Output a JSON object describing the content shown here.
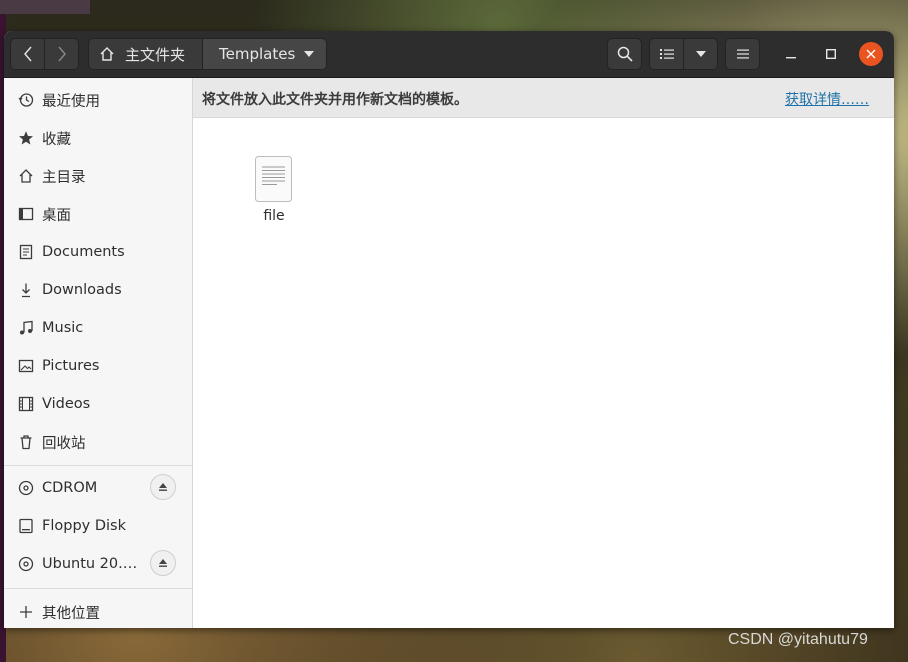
{
  "headerbar": {
    "path_home_label": "主文件夹",
    "path_current_label": "Templates"
  },
  "sidebar": {
    "items": [
      {
        "label": "最近使用",
        "icon": "clock-icon"
      },
      {
        "label": "收藏",
        "icon": "star-icon"
      },
      {
        "label": "主目录",
        "icon": "home-icon"
      },
      {
        "label": "桌面",
        "icon": "desktop-icon"
      },
      {
        "label": "Documents",
        "icon": "document-icon"
      },
      {
        "label": "Downloads",
        "icon": "download-icon"
      },
      {
        "label": "Music",
        "icon": "music-icon"
      },
      {
        "label": "Pictures",
        "icon": "picture-icon"
      },
      {
        "label": "Videos",
        "icon": "video-icon"
      },
      {
        "label": "回收站",
        "icon": "trash-icon"
      }
    ],
    "devices": [
      {
        "label": "CDROM",
        "icon": "disc-icon",
        "ejectable": true
      },
      {
        "label": "Floppy Disk",
        "icon": "drive-icon",
        "ejectable": false
      },
      {
        "label": "Ubuntu 20.0…",
        "icon": "disc-icon",
        "ejectable": true
      }
    ],
    "other_locations": {
      "label": "其他位置",
      "icon": "plus-icon"
    }
  },
  "infobar": {
    "message": "将文件放入此文件夹并用作新文档的模板。",
    "link": "获取详情……"
  },
  "files": [
    {
      "name": "file",
      "icon": "text-file-icon"
    }
  ],
  "watermark": "CSDN @yitahutu79",
  "colors": {
    "headerbar": "#2d2d2d",
    "close_button": "#e95420",
    "link": "#1f73a8",
    "sidebar": "#f6f6f6"
  }
}
